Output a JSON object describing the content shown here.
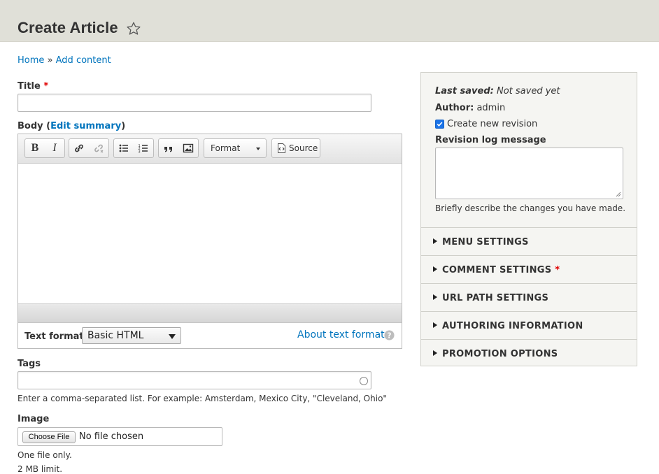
{
  "header": {
    "title": "Create Article"
  },
  "breadcrumb": {
    "home": "Home",
    "separator": "»",
    "add_content": "Add content"
  },
  "title_field": {
    "label": "Title",
    "required_mark": "*",
    "value": ""
  },
  "body_field": {
    "label_prefix": "Body (",
    "edit_summary": "Edit summary",
    "label_suffix": ")",
    "toolbar": {
      "bold": "B",
      "italic": "I",
      "format_label": "Format",
      "source_label": "Source"
    },
    "text_format_label": "Text format",
    "text_format_value": "Basic HTML",
    "about_link": "About text formats"
  },
  "tags_field": {
    "label": "Tags",
    "value": "",
    "description": "Enter a comma-separated list. For example: Amsterdam, Mexico City, \"Cleveland, Ohio\""
  },
  "image_field": {
    "label": "Image",
    "choose_button": "Choose File",
    "no_file": "No file chosen",
    "desc_1": "One file only.",
    "desc_2": "2 MB limit."
  },
  "sidebar": {
    "last_saved_label": "Last saved:",
    "last_saved_value": "Not saved yet",
    "author_label": "Author:",
    "author_value": "admin",
    "create_revision_label": "Create new revision",
    "create_revision_checked": true,
    "revision_log_label": "Revision log message",
    "revision_log_value": "",
    "revision_log_desc": "Briefly describe the changes you have made.",
    "details": [
      {
        "label": "MENU SETTINGS",
        "required": ""
      },
      {
        "label": "COMMENT SETTINGS",
        "required": "*"
      },
      {
        "label": "URL PATH SETTINGS",
        "required": ""
      },
      {
        "label": "AUTHORING INFORMATION",
        "required": ""
      },
      {
        "label": "PROMOTION OPTIONS",
        "required": ""
      }
    ]
  }
}
